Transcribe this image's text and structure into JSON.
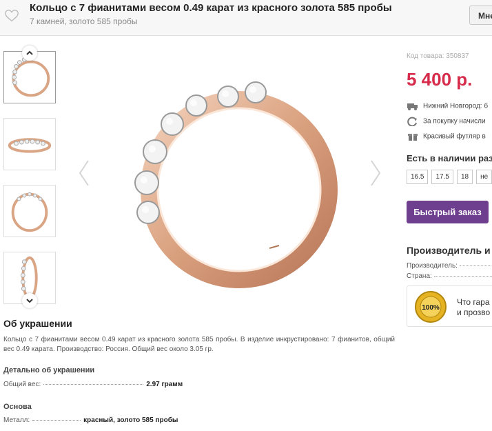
{
  "header": {
    "title": "Кольцо с 7 фианитами весом 0.49 карат из красного золота 585 пробы",
    "subtitle": "7 камней, золото 585 пробы",
    "button_label": "Мне"
  },
  "gallery": {
    "thumbnails": [
      "ring-angled",
      "ring-band-top",
      "ring-side",
      "ring-vertical"
    ]
  },
  "product": {
    "sku": "Код товара: 350837",
    "price": "5 400 р.",
    "delivery": "Нижний Новгород: б",
    "bonus": "За покупку начисли",
    "gift": "Красивый футляр в",
    "stock_title": "Есть в наличии раз",
    "sizes": [
      "16.5",
      "17.5",
      "18",
      "не"
    ],
    "quick_order": "Быстрый заказ",
    "manufacturer_title": "Производитель и",
    "manufacturer_label": "Производитель:",
    "country_label": "Страна:",
    "guarantee_line1": "Что гара",
    "guarantee_line2": "и прозво",
    "seal_text": "100%"
  },
  "about": {
    "title": "Об украшении",
    "description": "Кольцо с 7 фианитами весом 0.49 карат из красного золота 585 пробы. В изделие инкрустировано: 7 фианитов, общий вес 0.49 карата. Производство: Россия. Общий вес около 3.05 гр.",
    "detail_title": "Детально об украшении",
    "weight_label": "Общий вес:",
    "weight_value": "2.97 грамм",
    "base_title": "Основа",
    "metal_label": "Металл:",
    "metal_value": "красный, золото 585 пробы"
  },
  "colors": {
    "price": "#d62b4a",
    "button": "#6e3f8e",
    "gold": "#d9a585",
    "seal": "#e6b422"
  }
}
